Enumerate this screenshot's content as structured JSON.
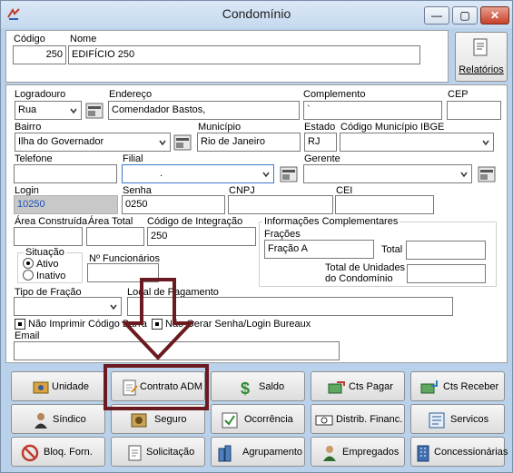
{
  "window": {
    "title": "Condomínio",
    "minimize": "—",
    "maximize": "▢",
    "close": "✕"
  },
  "top": {
    "codigo_label": "Código",
    "codigo_value": "250",
    "nome_label": "Nome",
    "nome_value": "EDIFÍCIO 250",
    "relatorios_label": "Relatórios"
  },
  "fields": {
    "logradouro_label": "Logradouro",
    "logradouro_value": "Rua",
    "endereco_label": "Endereço",
    "endereco_value": "Comendador Bastos,",
    "complemento_label": "Complemento",
    "complemento_value": "`",
    "cep_label": "CEP",
    "cep_value": "",
    "bairro_label": "Bairro",
    "bairro_value": "Ilha do Governador",
    "municipio_label": "Município",
    "municipio_value": "Rio de Janeiro",
    "estado_label": "Estado",
    "estado_value": "RJ",
    "ibge_label": "Código Município IBGE",
    "ibge_value": "",
    "telefone_label": "Telefone",
    "telefone_value": "",
    "filial_label": "Filial",
    "filial_value": ".",
    "gerente_label": "Gerente",
    "gerente_value": "",
    "login_label": "Login",
    "login_value": "10250",
    "senha_label": "Senha",
    "senha_value": "0250",
    "cnpj_label": "CNPJ",
    "cnpj_value": "",
    "cei_label": "CEI",
    "cei_value": "",
    "area_construida_label": "Área Construída",
    "area_construida_value": "",
    "area_total_label": "Área Total",
    "area_total_value": "",
    "codigo_integracao_label": "Código de Integração",
    "codigo_integracao_value": "250",
    "info_comp_label": "Informações Complementares",
    "fracoes_label": "Frações",
    "fracoes_value": "Fração A",
    "total_label": "Total",
    "total_value": "",
    "total_unidades_label_1": "Total de Unidades",
    "total_unidades_label_2": "do Condomínio",
    "total_unidades_value": "",
    "situacao_label": "Situação",
    "ativo_label": "Ativo",
    "inativo_label": "Inativo",
    "funcionarios_label": "Nº Funcionários",
    "funcionarios_value": "",
    "tipo_fracao_label": "Tipo de Fração",
    "tipo_fracao_value": "",
    "local_pagamento_label": "Local de Pagamento",
    "local_pagamento_value": "",
    "nao_imprimir_label": "Não Imprimir Código Barra",
    "nao_gerar_label": "Não Gerar Senha/Login Bureaux",
    "email_label": "Email",
    "email_value": ""
  },
  "buttons": {
    "unidade": "Unidade",
    "contrato_adm": "Contrato ADM",
    "saldo": "Saldo",
    "cts_pagar": "Cts Pagar",
    "cts_receber": "Cts Receber",
    "sindico": "Síndico",
    "seguro": "Seguro",
    "ocorrencia": "Ocorrência",
    "distrib_financ": "Distrib. Financ.",
    "servicos": "Servicos",
    "bloq_forn": "Bloq. Forn.",
    "solicitacao": "Solicitação",
    "agrupamento": "Agrupamento",
    "empregados": "Empregados",
    "concessionarias": "Concessionárias"
  },
  "colors": {
    "window_bg": "#b9d1ea",
    "highlight": "#6b1a1f",
    "login_text": "#1b4fb3"
  }
}
